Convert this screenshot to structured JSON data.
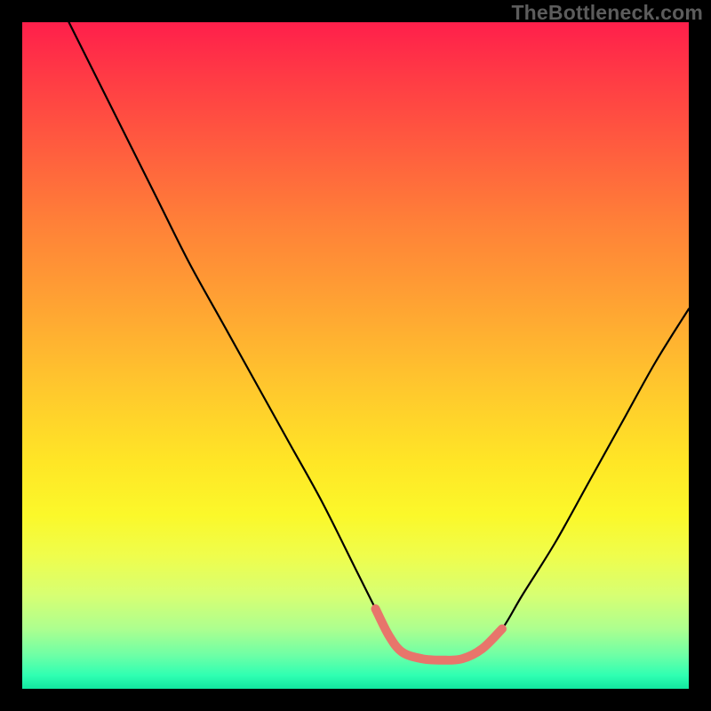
{
  "watermark": "TheBottleneck.com",
  "chart_data": {
    "type": "line",
    "title": "",
    "xlabel": "",
    "ylabel": "",
    "xlim": [
      0,
      100
    ],
    "ylim": [
      0,
      100
    ],
    "background_gradient": {
      "top": "#ff1f4b",
      "mid": "#ffe626",
      "bottom": "#12e7a0"
    },
    "series": [
      {
        "name": "bottleneck-curve",
        "type": "line",
        "color": "#000000",
        "x": [
          7,
          10,
          15,
          20,
          25,
          30,
          35,
          40,
          45,
          50,
          53,
          55,
          57,
          60,
          63,
          66,
          69,
          72,
          75,
          80,
          85,
          90,
          95,
          100
        ],
        "values": [
          100,
          94,
          84,
          74,
          64,
          55,
          46,
          37,
          28,
          18,
          12,
          8,
          5.5,
          4.5,
          4.3,
          4.5,
          6,
          9,
          14,
          22,
          31,
          40,
          49,
          57
        ]
      },
      {
        "name": "optimal-range-marker",
        "type": "line",
        "color": "#e8756b",
        "stroke_width_px": 10,
        "x": [
          53,
          55,
          57,
          60,
          63,
          66,
          69,
          72
        ],
        "values": [
          12,
          8,
          5.5,
          4.5,
          4.3,
          4.5,
          6,
          9
        ]
      }
    ],
    "note": "Axis values are relative percentages (0–100). y=100 at top, y=0 at bottom. No explicit axis ticks or labels are visible in the image."
  }
}
